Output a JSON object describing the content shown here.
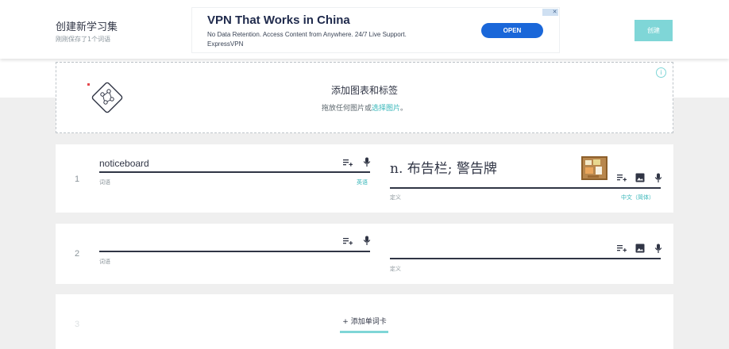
{
  "header": {
    "title": "创建新学习集",
    "subtitle": "刚刚保存了1个词语",
    "create_label": "创建"
  },
  "ad": {
    "title": "VPN That Works in China",
    "description": "No Data Retention. Access Content from Anywhere. 24/7 Live Support.",
    "brand": "ExpressVPN",
    "open_label": "OPEN",
    "close_glyph": "✕"
  },
  "dropzone": {
    "title": "添加图表和标签",
    "prefix": "拖放任何图片或",
    "link": "选择图片",
    "suffix": "。",
    "info_glyph": "i"
  },
  "cards": [
    {
      "number": "1",
      "term": "noticeboard",
      "term_label": "词语",
      "term_lang": "英语",
      "definition": "n. 布告栏; 警告牌",
      "definition_label": "定义",
      "definition_lang": "中文（简体）"
    },
    {
      "number": "2",
      "term": "",
      "term_label": "词语",
      "definition": "",
      "definition_label": "定义"
    }
  ],
  "add_card": {
    "number": "3",
    "label": "+ 添加单词卡"
  },
  "colors": {
    "accent": "#7fd6d7",
    "link": "#36b6b9",
    "text_dark": "#303545",
    "ad_button": "#1a67d9"
  },
  "icons": [
    "diamond-icon",
    "info-icon",
    "suggest-icon",
    "mic-icon",
    "image-icon"
  ]
}
